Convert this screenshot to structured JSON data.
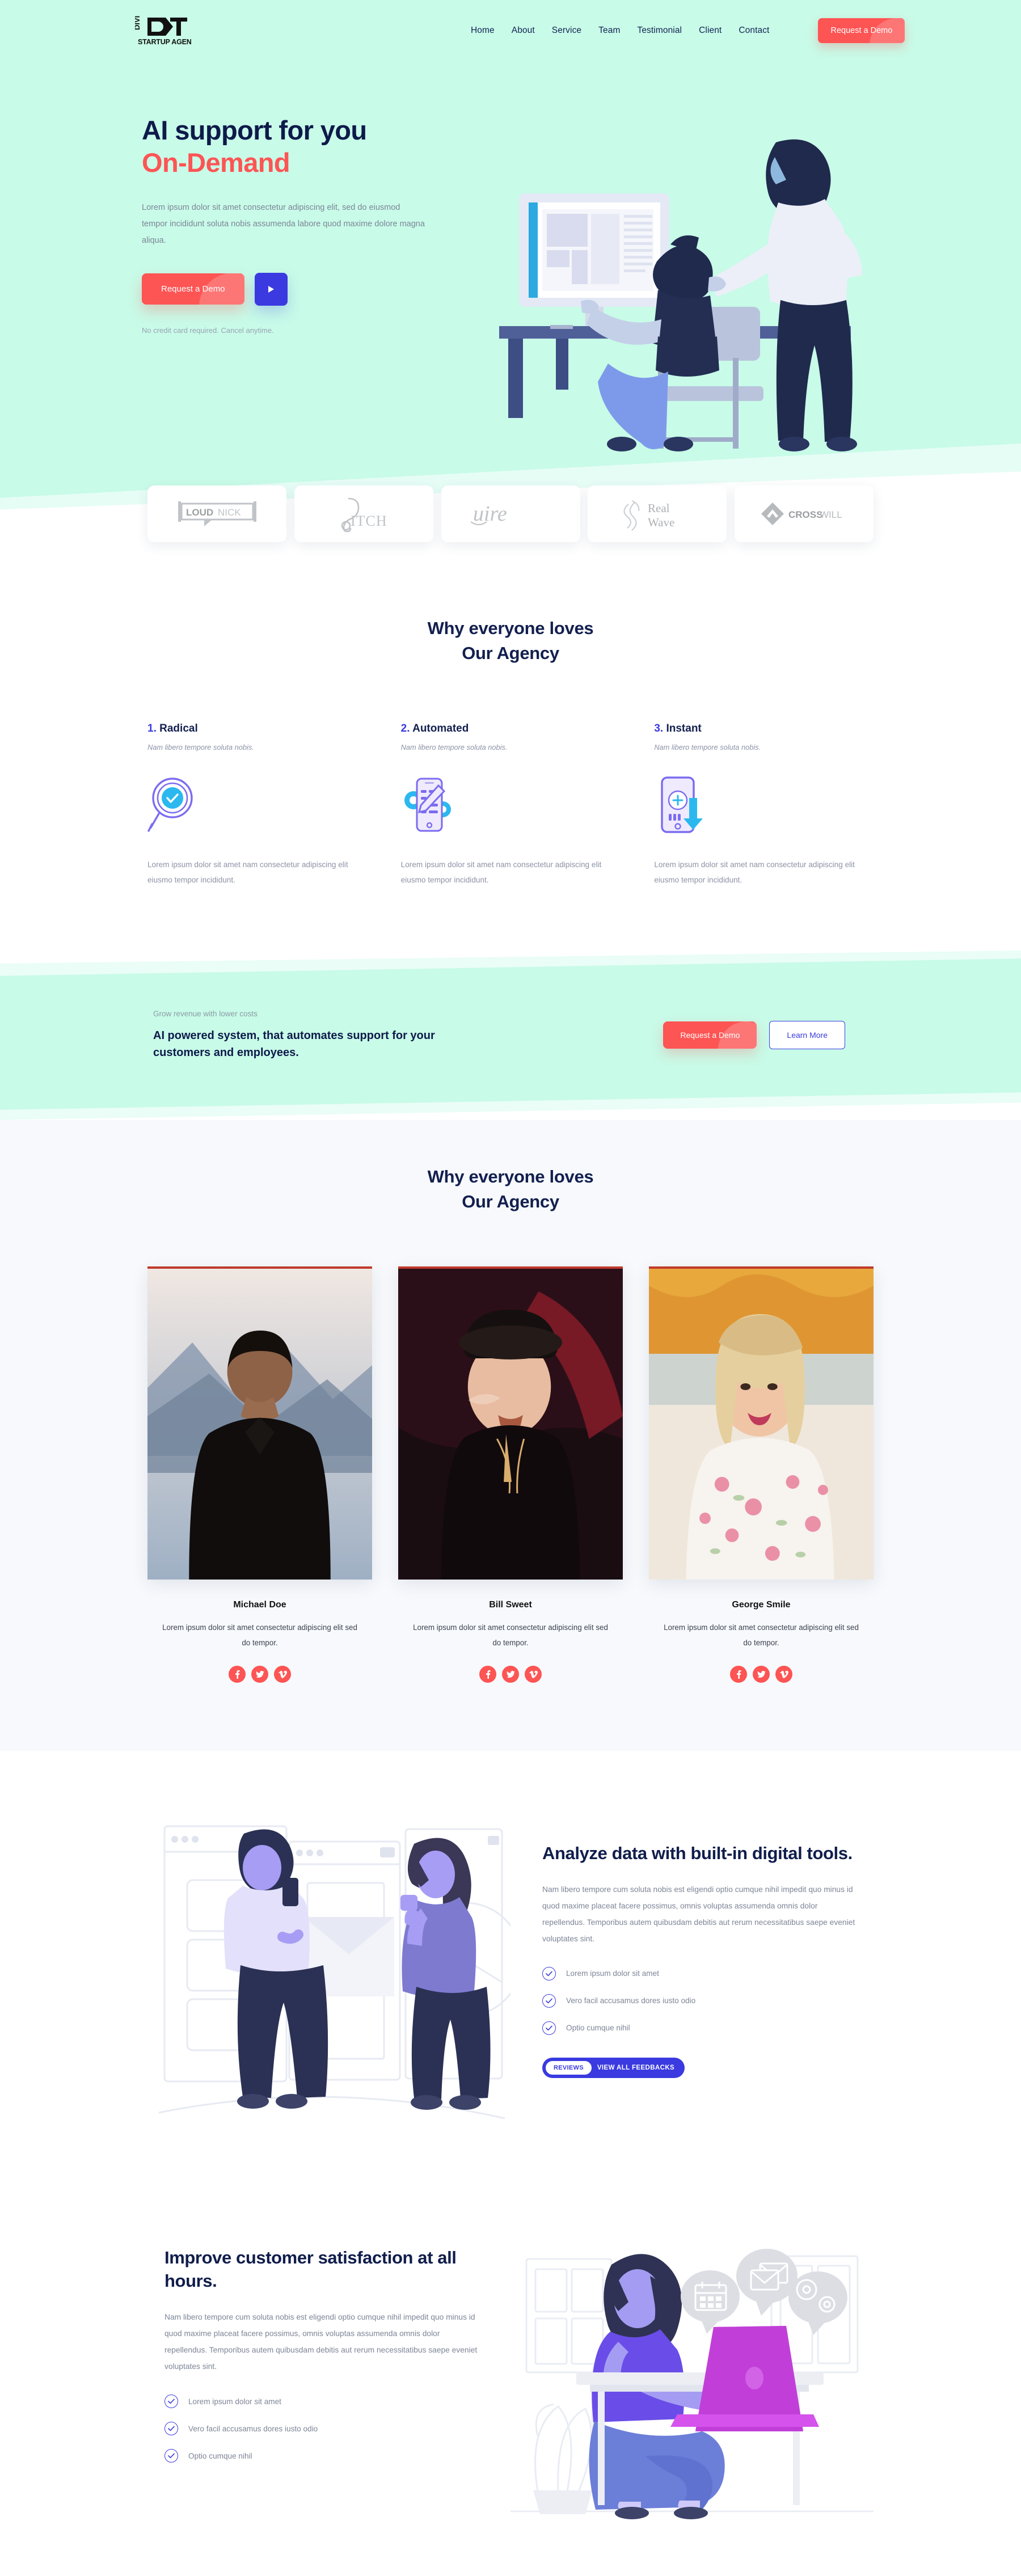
{
  "brand": {
    "logo_top": "DIVI",
    "logo_main": "DCT",
    "logo_sub": "STARTUP AGENCY"
  },
  "colors": {
    "mint": "#c8fbe8",
    "coral": "#fd5454",
    "indigo": "#3a3ae0",
    "navy": "#0e1a4a",
    "muted": "#8c93a6"
  },
  "nav": {
    "links": [
      {
        "label": "Home"
      },
      {
        "label": "About"
      },
      {
        "label": "Service"
      },
      {
        "label": "Team"
      },
      {
        "label": "Testimonial"
      },
      {
        "label": "Client"
      },
      {
        "label": "Contact"
      }
    ],
    "cta_label": "Request a Demo"
  },
  "hero": {
    "title_line1": "AI support for you",
    "title_line2": "On-Demand",
    "paragraph": "Lorem ipsum dolor sit amet consectetur adipiscing elit, sed do eiusmod tempor incididunt soluta nobis assumenda labore quod maxime dolore magna aliqua.",
    "primary_button": "Request a Demo",
    "play_button_icon": "play-icon",
    "note": "No credit card required. Cancel anytime.",
    "illustration": "people-at-computer-illustration"
  },
  "clients": {
    "logos": [
      {
        "name": "loudnick-logo",
        "text": "LOUDNICK"
      },
      {
        "name": "pitch-logo",
        "text": "PITCH"
      },
      {
        "name": "uire-logo",
        "text": "uire"
      },
      {
        "name": "real-wave-logo",
        "text": "Real Wave"
      },
      {
        "name": "crosswill-logo",
        "text": "CROSSWILL"
      }
    ]
  },
  "features": {
    "title_line1": "Why everyone loves",
    "title_line2": "Our Agency",
    "items": [
      {
        "number": "1.",
        "title": "Radical",
        "subtitle": "Nam libero tempore soluta nobis.",
        "icon": "magnifier-check-icon",
        "body": "Lorem ipsum dolor sit amet nam consectetur adipiscing elit eiusmo tempor incididunt."
      },
      {
        "number": "2.",
        "title": "Automated",
        "subtitle": "Nam libero tempore soluta nobis.",
        "icon": "phone-gear-pencil-icon",
        "body": "Lorem ipsum dolor sit amet nam consectetur adipiscing elit eiusmo tempor incididunt."
      },
      {
        "number": "3.",
        "title": "Instant",
        "subtitle": "Nam libero tempore soluta nobis.",
        "icon": "phone-download-icon",
        "body": "Lorem ipsum dolor sit amet nam consectetur adipiscing elit eiusmo tempor incididunt."
      }
    ]
  },
  "cta_band": {
    "kicker": "Grow revenue with lower costs",
    "headline": "AI powered system, that automates support for your customers and employees.",
    "primary_button": "Request a Demo",
    "secondary_button": "Learn More"
  },
  "team": {
    "title_line1": "Why everyone loves",
    "title_line2": "Our Agency",
    "members": [
      {
        "name": "Michael Doe",
        "bio": "Lorem ipsum dolor sit amet consectetur adipiscing elit sed do tempor.",
        "photo": "man-in-black-jacket-mountains-photo",
        "socials": [
          "facebook-icon",
          "twitter-icon",
          "vimeo-icon"
        ]
      },
      {
        "name": "Bill Sweet",
        "bio": "Lorem ipsum dolor sit amet consectetur adipiscing elit sed do tempor.",
        "photo": "woman-in-cap-dark-photo",
        "socials": [
          "facebook-icon",
          "twitter-icon",
          "vimeo-icon"
        ]
      },
      {
        "name": "George Smile",
        "bio": "Lorem ipsum dolor sit amet consectetur adipiscing elit sed do tempor.",
        "photo": "blonde-woman-floral-dress-photo",
        "socials": [
          "facebook-icon",
          "twitter-icon",
          "vimeo-icon"
        ]
      }
    ]
  },
  "analyze": {
    "heading": "Analyze data with built-in digital tools.",
    "paragraph": "Nam libero tempore cum soluta nobis est eligendi optio cumque nihil impedit quo minus id quod maxime placeat facere possimus, omnis voluptas assumenda omnis dolor repellendus. Temporibus autem quibusdam debitis aut rerum necessitatibus saepe eveniet voluptates sint.",
    "checks": [
      "Lorem ipsum dolor sit amet",
      "Vero facil accusamus dores iusto odio",
      "Optio cumque nihil"
    ],
    "pill_badge": "REVIEWS",
    "pill_text": "VIEW ALL FEEDBACKS",
    "illustration": "two-people-messaging-illustration"
  },
  "improve": {
    "heading": "Improve customer satisfaction at all hours.",
    "paragraph": "Nam libero tempore cum soluta nobis est eligendi optio cumque nihil impedit quo minus id quod maxime placeat facere possimus, omnis voluptas assumenda omnis dolor repellendus. Temporibus autem quibusdam debitis aut rerum necessitatibus saepe eveniet voluptates sint.",
    "checks": [
      "Lorem ipsum dolor sit amet",
      "Vero facil accusamus dores iusto odio",
      "Optio cumque nihil"
    ],
    "illustration": "woman-at-laptop-illustration"
  }
}
